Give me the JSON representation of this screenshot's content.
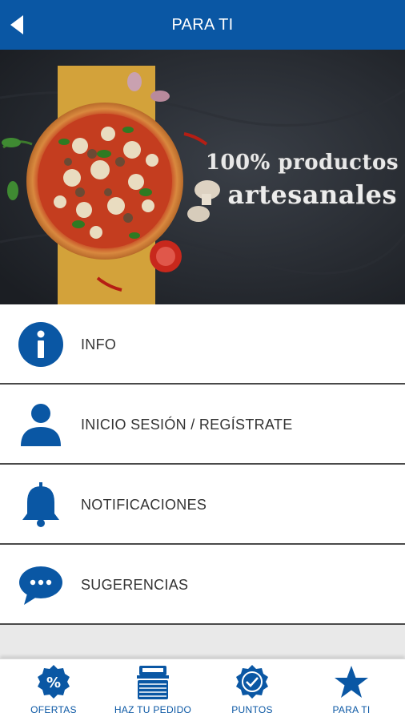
{
  "header": {
    "title": "PARA TI"
  },
  "banner": {
    "line1": "100% productos",
    "line2": "artesanales"
  },
  "menu": [
    {
      "label": "INFO",
      "icon": "info-icon"
    },
    {
      "label": "INICIO SESIÓN / REGÍSTRATE",
      "icon": "user-icon"
    },
    {
      "label": "NOTIFICACIONES",
      "icon": "bell-icon"
    },
    {
      "label": "SUGERENCIAS",
      "icon": "chat-bubble-icon"
    }
  ],
  "bottom_nav": [
    {
      "label": "OFERTAS",
      "icon": "percent-badge-icon"
    },
    {
      "label": "HAZ TU PEDIDO",
      "icon": "pizza-box-icon"
    },
    {
      "label": "PUNTOS",
      "icon": "check-seal-icon"
    },
    {
      "label": "PARA TI",
      "icon": "star-icon"
    }
  ],
  "colors": {
    "brand_blue": "#0a57a4",
    "background": "#e9e9e9",
    "text": "#333333"
  }
}
